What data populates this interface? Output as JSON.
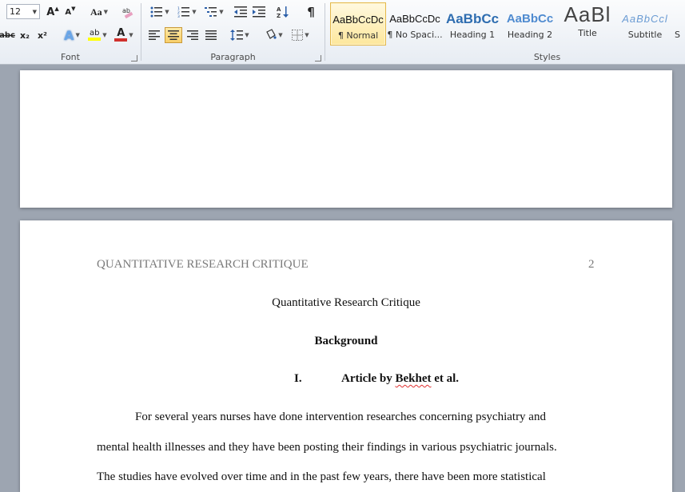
{
  "ribbon": {
    "font_group": {
      "label": "Font",
      "font_size": "12",
      "grow_font_icon": "A",
      "shrink_font_icon": "A",
      "change_case_label": "Aa",
      "strikethrough_label": "abc",
      "subscript_label": "x₂",
      "superscript_label": "x²",
      "text_effects_label": "A",
      "highlight_label": "ab",
      "font_color_label": "A"
    },
    "paragraph_group": {
      "label": "Paragraph",
      "show_marks_label": "¶"
    },
    "styles_group": {
      "label": "Styles",
      "items": [
        {
          "sample": "AaBbCcDc",
          "name": "¶ Normal"
        },
        {
          "sample": "AaBbCcDc",
          "name": "¶ No Spaci..."
        },
        {
          "sample": "AaBbCc",
          "name": "Heading 1"
        },
        {
          "sample": "AaBbCc",
          "name": "Heading 2"
        },
        {
          "sample": "AaBl",
          "name": "Title"
        },
        {
          "sample": "AaBbCcl",
          "name": "Subtitle"
        },
        {
          "sample": "",
          "name": "S"
        }
      ]
    },
    "colors": {
      "highlight": "#ffff00",
      "font_color": "#d0312d",
      "heading_blue": "#2e74b5",
      "selected_tile": "#fde79c"
    }
  },
  "document": {
    "running_head": "QUANTITATIVE RESEARCH CRITIQUE",
    "page_number": "2",
    "title": "Quantitative Research Critique",
    "heading": "Background",
    "list_number": "I.",
    "article_heading_prefix": "Article by ",
    "article_heading_name": "Bekhet",
    "article_heading_suffix": " et al.",
    "paragraph_lines": [
      "For several  years nurses have done intervention researches  concerning psychiatry and",
      "mental health illnesses  and they have been posting their findings in various  psychiatric journals.",
      "The studies have evolved over time and in the past few years, there have been more statistical"
    ]
  }
}
